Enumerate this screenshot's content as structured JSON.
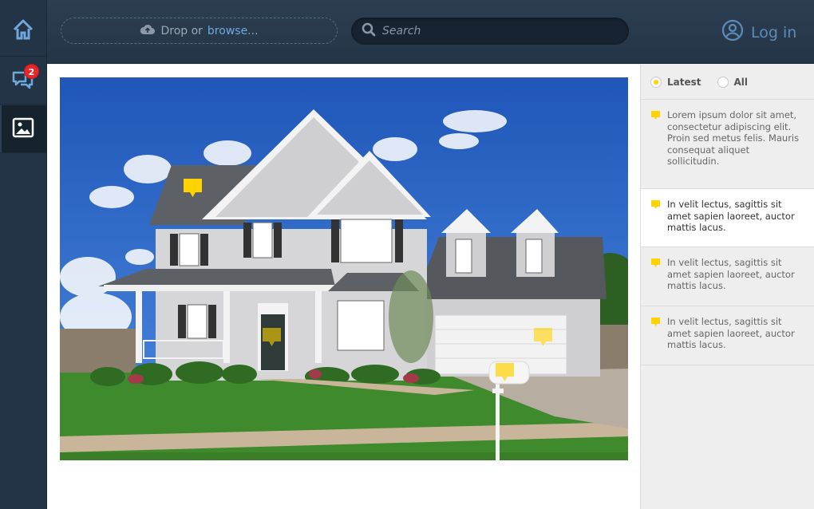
{
  "sidebar": {
    "items": [
      {
        "name": "home",
        "icon": "home-icon"
      },
      {
        "name": "comments",
        "icon": "comments-icon",
        "badge": "2"
      },
      {
        "name": "images",
        "icon": "image-icon",
        "active": true
      }
    ]
  },
  "topbar": {
    "drop_text": "Drop or",
    "browse_link": "browse...",
    "search_placeholder": "Search",
    "login_label": "Log in"
  },
  "panel": {
    "filters": [
      {
        "label": "Latest",
        "selected": true
      },
      {
        "label": "All",
        "selected": false
      }
    ],
    "comments": [
      {
        "text": "Lorem ipsum dolor sit amet, consectetur adipiscing elit. Proin sed metus felis. Mauris consequat aliquet sollicitudin."
      },
      {
        "text": "In velit lectus, sagittis sit amet sapien laoreet, auctor mattis lacus.",
        "selected": true
      },
      {
        "text": "In velit lectus, sagittis sit amet sapien laoreet, auctor mattis lacus."
      },
      {
        "text": "In velit lectus, sagittis sit amet sapien laoreet, auctor mattis lacus."
      }
    ]
  },
  "colors": {
    "sidebar": "#243447",
    "topbar": "#2c3e52",
    "accent": "#ffd200",
    "link": "#6fa8dc",
    "badge": "#e5262d"
  }
}
